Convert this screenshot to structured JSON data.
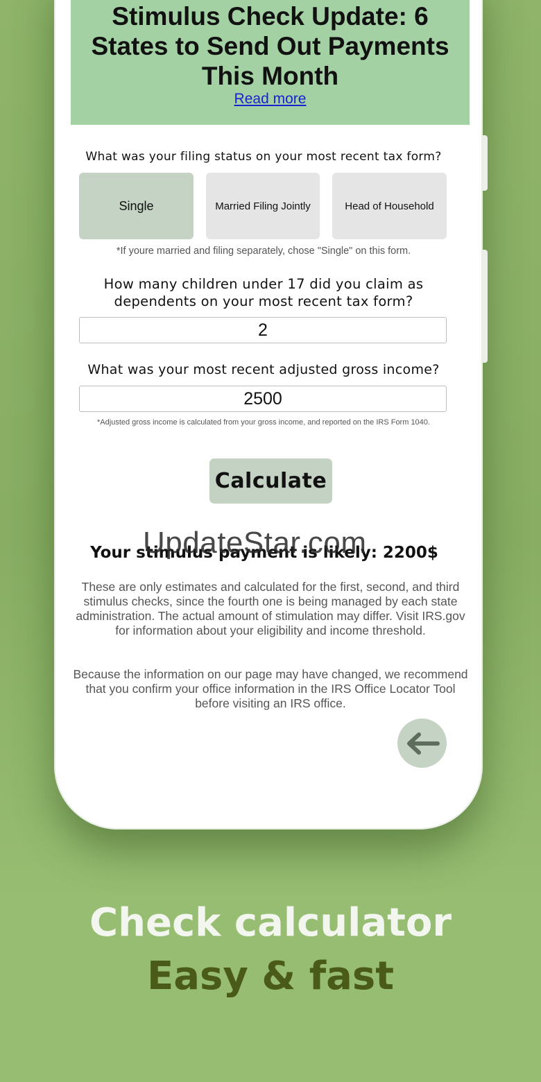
{
  "banner": {
    "title": "Stimulus Check Update: 6 States to Send Out Payments This Month",
    "link_label": "Read more"
  },
  "filing_status": {
    "question": "What was your filing status on your most recent tax form?",
    "options": [
      "Single",
      "Married Filing Jointly",
      "Head of Household"
    ],
    "selected": "Single",
    "note": "*If youre married and filing separately, chose \"Single\" on this form."
  },
  "children": {
    "question": "How many children under 17 did you claim as dependents on your most recent tax form?",
    "value": "2"
  },
  "income": {
    "question": "What was your most recent adjusted gross income?",
    "value": "2500",
    "note": "*Adjusted gross income is calculated from your gross income, and reported on the IRS Form 1040."
  },
  "calculate_label": "Calculate",
  "result_text": "Your stimulus payment is likely: 2200$",
  "disclaimer_1": "These are only estimates and calculated for the first, second, and third stimulus checks, since the fourth one is being managed by each state administration. The actual amount of stimulation may differ. Visit IRS.gov for information about your eligibility and income threshold.",
  "disclaimer_2": "Because the information on our page may have changed, we recommend that you confirm your office information in the IRS Office Locator Tool before visiting an IRS office.",
  "watermark": "UpdateStar.com",
  "tagline": {
    "line1": "Check calculator",
    "line2": "Easy & fast"
  },
  "colors": {
    "background": "#97bd72",
    "banner": "#a3d1a4",
    "selected_option": "#c4d3c3",
    "tagline_dark": "#4a5a18"
  }
}
